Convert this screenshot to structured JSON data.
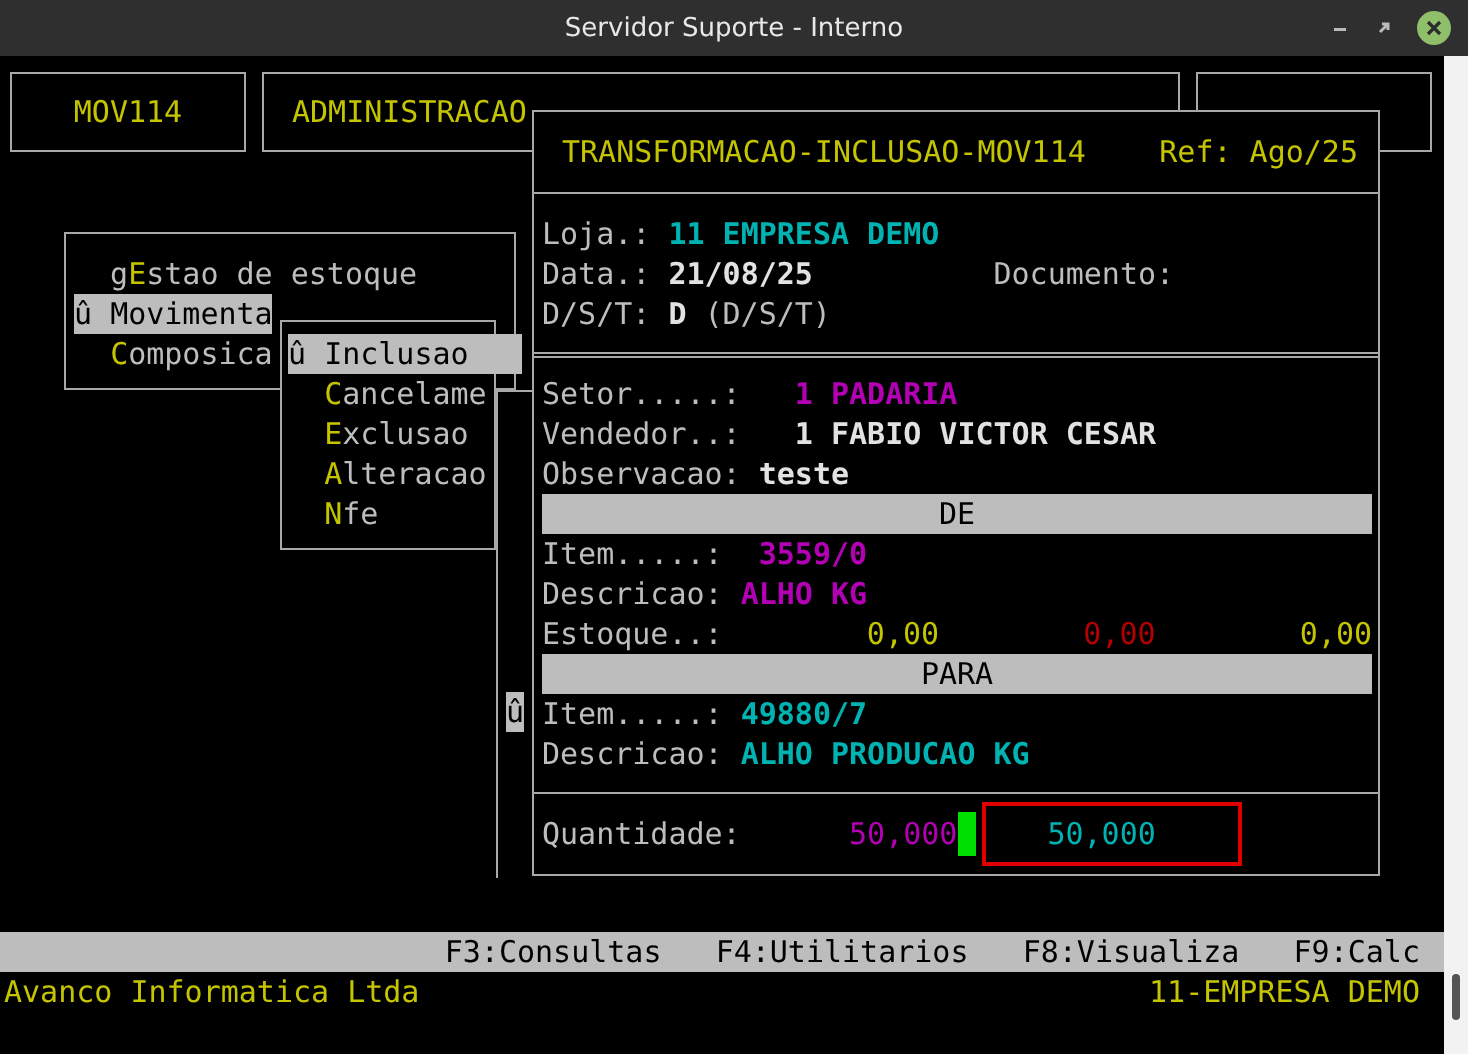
{
  "window": {
    "title": "Servidor Suporte - Interno"
  },
  "header_boxes": [
    {
      "label": "MOV114"
    },
    {
      "label": "ADMINISTRACAO"
    }
  ],
  "menu": {
    "items": [
      {
        "before": "g",
        "hotkey": "E",
        "after": "stao de estoque",
        "selected": false
      },
      {
        "marker": "û",
        "hotkey": "M",
        "after": "ovimenta",
        "selected": true
      },
      {
        "hotkey": "C",
        "after": "omposica",
        "selected": false
      }
    ]
  },
  "submenu": {
    "items": [
      {
        "marker": "û",
        "hotkey": "I",
        "after": "nclusao",
        "selected": true
      },
      {
        "hotkey": "C",
        "after": "ancelame",
        "selected": false
      },
      {
        "hotkey": "E",
        "after": "xclusao",
        "selected": false
      },
      {
        "hotkey": "A",
        "after": "lteracao",
        "selected": false
      },
      {
        "hotkey": "N",
        "after": "fe",
        "selected": false
      }
    ]
  },
  "back_window": {
    "marker": "û"
  },
  "dialog": {
    "title": "TRANSFORMACAO-INCLUSAO-MOV114",
    "ref": "Ref: Ago/25",
    "header_fields": [
      {
        "label": "Loja.:",
        "value": "11 EMPRESA DEMO",
        "color": "#00b2b2"
      },
      {
        "label": "Data.:",
        "value": "21/08/25",
        "color": "#e2e2e2",
        "extra_label": "Documento:"
      },
      {
        "label": "D/S/T:",
        "value": "D",
        "color": "#e2e2e2",
        "note": "(D/S/T)"
      }
    ],
    "rows": [
      {
        "kind": "coded",
        "label": "Setor.....:",
        "value": "1 PADARIA",
        "color": "#b400b4"
      },
      {
        "kind": "coded",
        "label": "Vendedor..:",
        "value": "1 FABIO VICTOR CESAR",
        "color": "#e2e2e2"
      },
      {
        "kind": "field",
        "label": "Observacao:",
        "value": "teste",
        "color": "#e2e2e2"
      },
      {
        "kind": "bar",
        "text": "DE"
      },
      {
        "kind": "item",
        "label": "Item.....:",
        "value": "3559/0",
        "color": "#b400b4"
      },
      {
        "kind": "field",
        "label": "Descricao:",
        "value": "ALHO KG",
        "color": "#b400b4"
      },
      {
        "kind": "stock",
        "label": "Estoque..:",
        "values": [
          {
            "text": "0,00",
            "color": "#c4c400"
          },
          {
            "text": "0,00",
            "color": "#b40000"
          },
          {
            "text": "0,00",
            "color": "#c4c400"
          }
        ]
      },
      {
        "kind": "bar",
        "text": "PARA"
      },
      {
        "kind": "item",
        "label": "Item.....:",
        "value": "49880/7",
        "color": "#00b2b2"
      },
      {
        "kind": "field",
        "label": "Descricao:",
        "value": "ALHO PRODUCAO KG",
        "color": "#00b2b2"
      }
    ],
    "quantity": {
      "label": "Quantidade:",
      "value": "50,000",
      "input_value": "50,000"
    }
  },
  "function_keys": [
    "F3:Consultas",
    "F4:Utilitarios",
    "F8:Visualiza",
    "F9:Calc"
  ],
  "status_bar": {
    "left": "Avanco Informatica Ltda",
    "right": "11-EMPRESA DEMO"
  }
}
